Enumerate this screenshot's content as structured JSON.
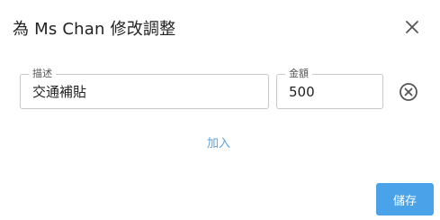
{
  "dialog": {
    "title": "為 Ms Chan 修改調整",
    "close_icon": "close-icon"
  },
  "row": {
    "description_label": "描述",
    "description_value": "交通補貼",
    "amount_label": "金額",
    "amount_value": "500",
    "remove_icon": "circle-x-icon"
  },
  "add_label": "加入",
  "save_label": "儲存",
  "colors": {
    "accent": "#4aa3e8",
    "link": "#5aa3dc"
  }
}
